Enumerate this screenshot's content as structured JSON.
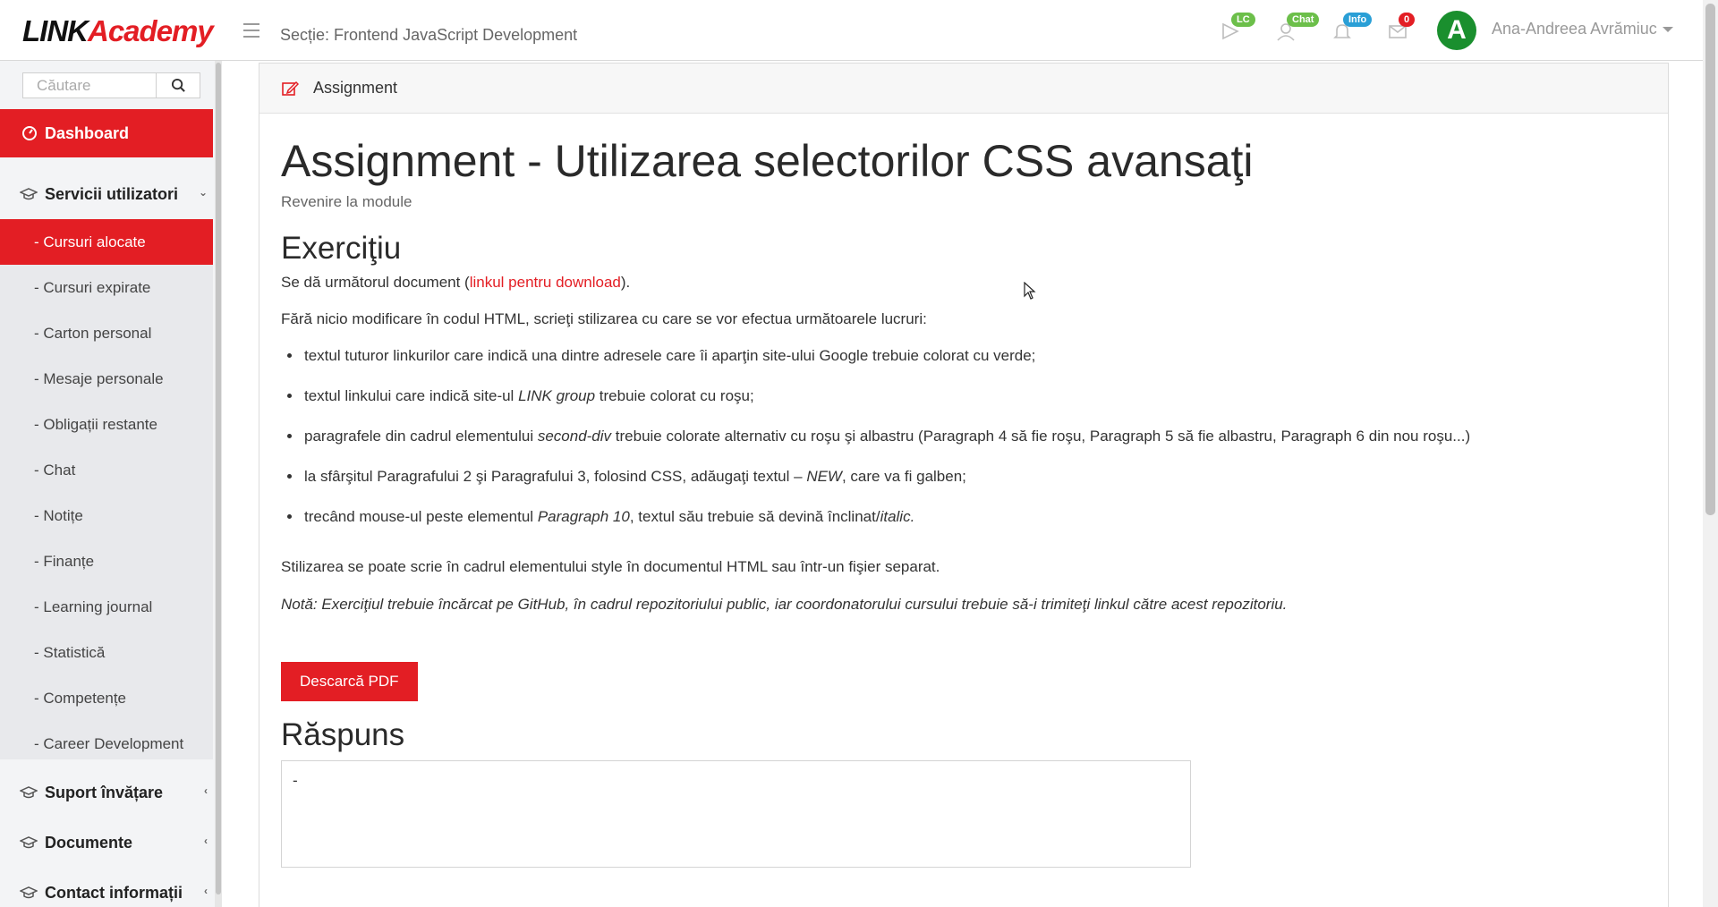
{
  "header": {
    "logo_link": "LINK",
    "logo_academy": "Academy",
    "section": "Secție: Frontend JavaScript Development",
    "icons": [
      {
        "name": "lc-icon",
        "badge": "LC",
        "color": "#6cbf4a"
      },
      {
        "name": "chat-icon",
        "badge": "Chat",
        "color": "#6cbf4a"
      },
      {
        "name": "bell-icon",
        "badge": "Info",
        "color": "#2a9fd6"
      },
      {
        "name": "envelope-icon",
        "badge": "0",
        "color": "#e31e24"
      }
    ],
    "avatar_letter": "A",
    "user_name": "Ana-Andreea Avrămiuc"
  },
  "sidebar": {
    "search_placeholder": "Căutare",
    "dashboard": "Dashboard",
    "group_services": "Servicii utilizatori",
    "items": [
      "- Cursuri alocate",
      "- Cursuri expirate",
      "- Carton personal",
      "- Mesaje personale",
      "- Obligații restante",
      "- Chat",
      "- Notițe",
      "- Finanțe",
      "- Learning journal",
      "- Statistică",
      "- Competențe",
      "- Career Development"
    ],
    "group_support": "Suport învățare",
    "group_documents": "Documente",
    "group_contact": "Contact informații"
  },
  "card": {
    "header_label": "Assignment",
    "title": "Assignment - Utilizarea selectorilor CSS avansaţi",
    "back_link": "Revenire la module",
    "exercise_heading": "Exerciţiu",
    "intro_prefix": "Se dă următorul document (",
    "intro_link": "linkul pentru download",
    "intro_suffix": ").",
    "instructions": "Fără nicio modificare în codul HTML, scrieţi stilizarea cu care se vor efectua următoarele lucruri:",
    "tasks": [
      {
        "pre": "textul tuturor linkurilor care indică una dintre adresele care îi aparţin site-ului Google trebuie colorat cu verde;",
        "em": "",
        "post": ""
      },
      {
        "pre": "textul linkului care indică site-ul ",
        "em": "LINK group",
        "post": " trebuie colorat cu roşu;"
      },
      {
        "pre": "paragrafele din cadrul elementului ",
        "em": "second-div",
        "post": " trebuie colorate alternativ cu roşu şi albastru (Paragraph 4 să fie roşu, Paragraph 5 să fie albastru, Paragraph 6 din nou roşu...)"
      },
      {
        "pre": "la sfârşitul Paragrafului 2 şi Paragrafului 3, folosind CSS, adăugaţi textul – ",
        "em": "NEW",
        "post": ", care va fi galben;"
      },
      {
        "pre": "trecând mouse-ul peste elementul ",
        "em": "Paragraph 10",
        "post": ", textul său trebuie să devină înclinat/",
        "em2": "italic."
      }
    ],
    "style_note": "Stilizarea se poate scrie în cadrul elementului style în documentul HTML sau într-un fişier separat.",
    "nota": "Notă: Exerciţiul trebuie încărcat pe GitHub, în cadrul repozitoriului public, iar coordonatorului cursului trebuie să-i trimiteţi linkul către acest repozitoriu.",
    "pdf_button": "Descarcă PDF",
    "answer_heading": "Răspuns",
    "answer_value": "-"
  },
  "colors": {
    "accent": "#e31e24",
    "avatar": "#1a8f2e"
  }
}
